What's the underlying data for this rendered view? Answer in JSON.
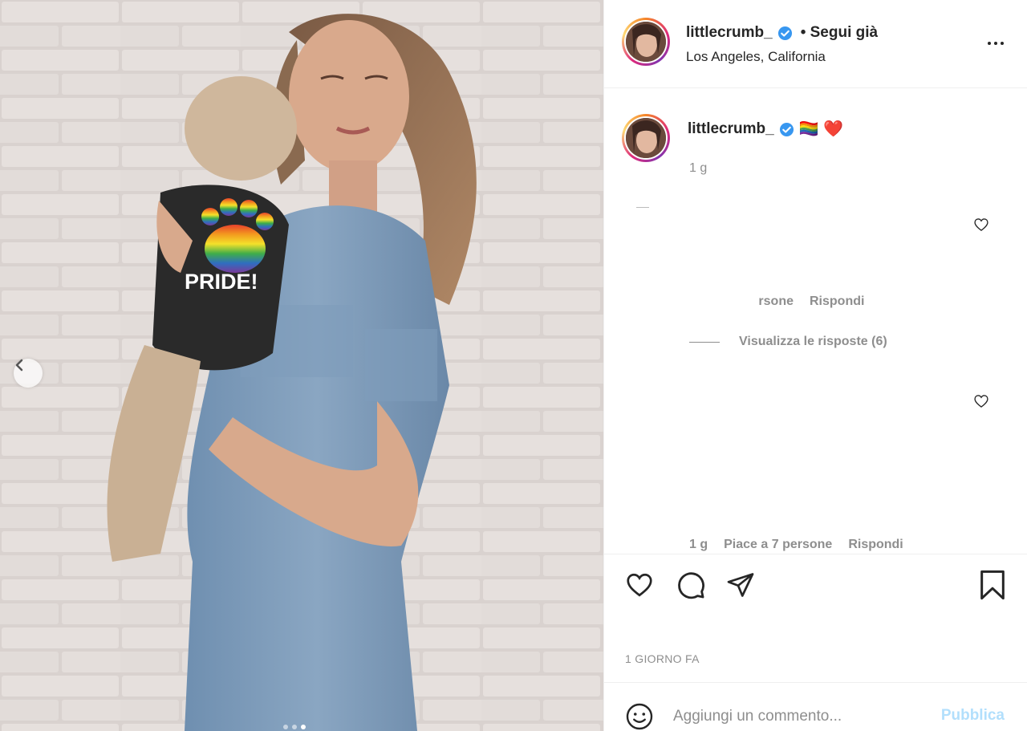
{
  "post": {
    "username": "littlecrumb_",
    "follow_status": "• Segui già",
    "location": "Los Angeles, California",
    "photo_shirt_text": "PRIDE!"
  },
  "caption": {
    "username": "littlecrumb_",
    "emojis": "🏳️‍🌈 ❤️",
    "time": "1 g"
  },
  "comment_rows": [
    {
      "meta_partial": "rsone",
      "reply_label": "Rispondi",
      "view_replies": "Visualizza le risposte (6)"
    },
    {
      "time": "1 g",
      "likes": "Piace a 7 persone",
      "reply_label": "Rispondi"
    }
  ],
  "footer": {
    "date_label": "1 GIORNO FA",
    "comment_placeholder": "Aggiungi un commento...",
    "publish_label": "Pubblica"
  },
  "carousel": {
    "slide_count": 3,
    "active_index": 2
  },
  "colors": {
    "publish_disabled": "#b2dffc",
    "verified": "#3897f0",
    "secondary_text": "#8e8e8e"
  }
}
